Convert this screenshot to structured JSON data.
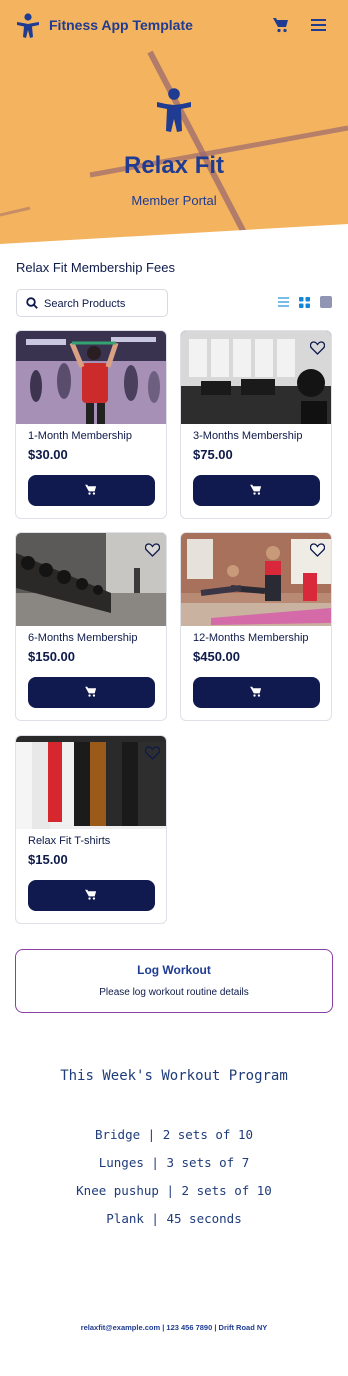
{
  "header": {
    "app_title": "Fitness App Template",
    "icons": [
      "person-logo-icon",
      "cart-icon",
      "hamburger-menu-icon"
    ]
  },
  "hero": {
    "title": "Relax Fit",
    "subtitle": "Member Portal"
  },
  "products": {
    "heading": "Relax Fit Membership Fees",
    "search": {
      "placeholder": "Search Products",
      "value": ""
    },
    "view_modes": [
      "list-view-icon",
      "grid-view-icon",
      "single-view-icon"
    ],
    "active_view": "grid",
    "items": [
      {
        "name": "1-Month Membership",
        "price": "$30.00",
        "image": "group-fitness-class"
      },
      {
        "name": "3-Months Membership",
        "price": "$75.00",
        "image": "gym-treadmills-bw"
      },
      {
        "name": "6-Months Membership",
        "price": "$150.00",
        "image": "dumbbell-rack-gym"
      },
      {
        "name": "12-Months Membership",
        "price": "$450.00",
        "image": "women-mat-exercise"
      },
      {
        "name": "Relax Fit T-shirts",
        "price": "$15.00",
        "image": "tshirts-on-rack"
      }
    ]
  },
  "log_workout": {
    "title": "Log Workout",
    "description": "Please log workout routine details"
  },
  "program": {
    "title": "This Week's Workout Program",
    "items": [
      "Bridge | 2 sets of 10",
      "Lunges | 3 sets of 7",
      "Knee pushup | 2 sets of 10",
      "Plank | 45 seconds"
    ]
  },
  "footer": {
    "text": "relaxfit@example.com | 123 456 7890 | Drift Road NY"
  },
  "colors": {
    "hero_bg": "#f4b35e",
    "brand_blue": "#1f3c92",
    "button_navy": "#111a4f",
    "log_border": "#8a3fa5"
  }
}
